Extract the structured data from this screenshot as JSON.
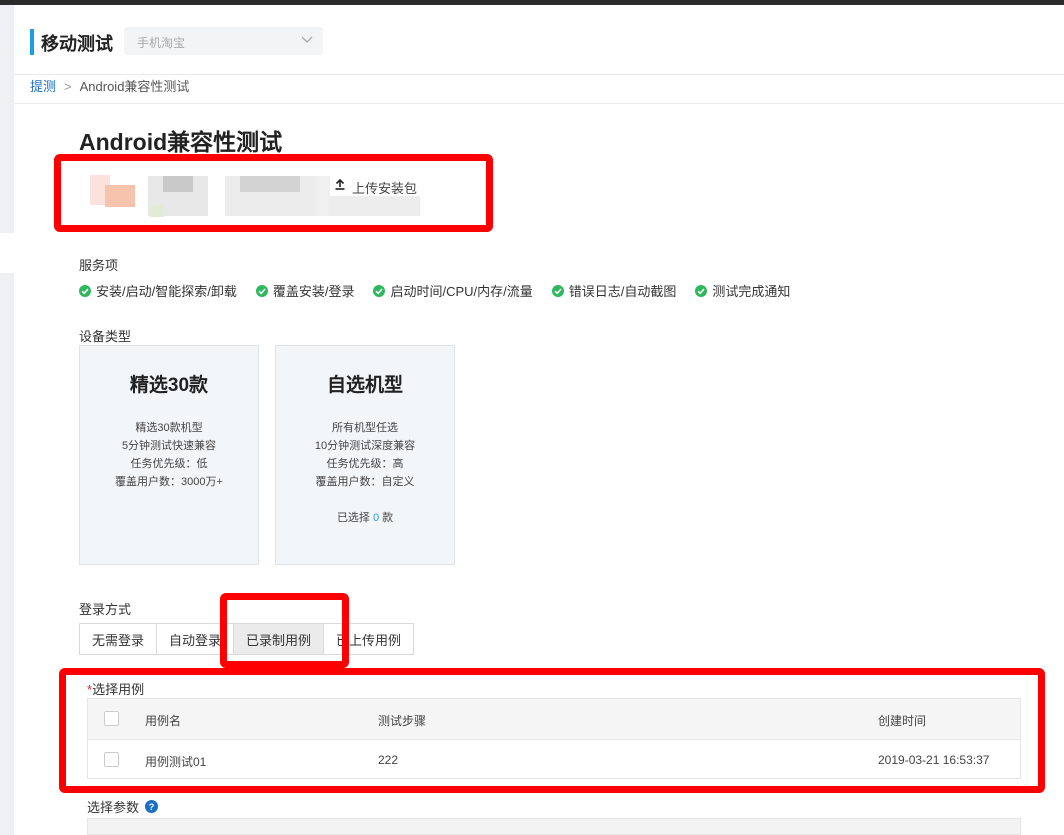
{
  "header": {
    "app_title": "移动测试",
    "app_select_value": "手机淘宝"
  },
  "breadcrumb": {
    "root": "提测",
    "separator": ">",
    "current": "Android兼容性测试"
  },
  "page_title": "Android兼容性测试",
  "upload": {
    "label": "上传安装包",
    "icon": "upload-icon"
  },
  "services": {
    "label": "服务项",
    "items": [
      "安装/启动/智能探索/卸载",
      "覆盖安装/登录",
      "启动时间/CPU/内存/流量",
      "错误日志/自动截图",
      "测试完成通知"
    ],
    "icon": "check-circle-icon",
    "icon_color": "#2eb85c"
  },
  "device_type": {
    "label": "设备类型",
    "cards": [
      {
        "title": "精选30款",
        "lines": [
          "精选30款机型",
          "5分钟测试快速兼容",
          "任务优先级：低",
          "覆盖用户数：3000万+"
        ]
      },
      {
        "title": "自选机型",
        "lines": [
          "所有机型任选",
          "10分钟测试深度兼容",
          "任务优先级：高",
          "覆盖用户数：自定义"
        ],
        "selected_prefix": "已选择",
        "selected_count": "0",
        "selected_suffix": "款"
      }
    ]
  },
  "login": {
    "label": "登录方式",
    "tabs": [
      "无需登录",
      "自动登录",
      "已录制用例",
      "已上传用例"
    ],
    "active_index": 2
  },
  "cases": {
    "required_mark": "*",
    "label": "选择用例",
    "columns": [
      "用例名",
      "测试步骤",
      "创建时间"
    ],
    "rows": [
      {
        "name": "用例测试01",
        "steps": "222",
        "created": "2019-03-21 16:53:37"
      }
    ]
  },
  "params": {
    "label": "选择参数",
    "icon": "help-circle-icon"
  },
  "colors": {
    "accent": "#1ba1e2",
    "annotation_red": "#ff0000",
    "link": "#1a6fc4"
  }
}
